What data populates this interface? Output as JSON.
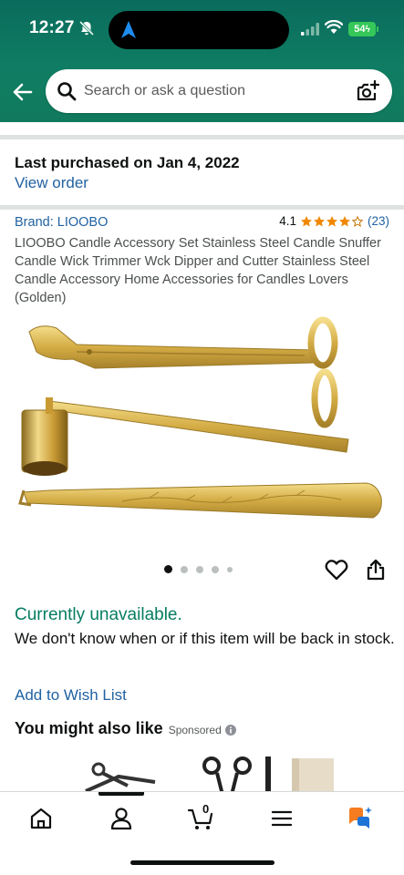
{
  "status_bar": {
    "time": "12:27",
    "battery": "54"
  },
  "search": {
    "placeholder": "Search or ask a question"
  },
  "purchase": {
    "last_purchased": "Last purchased on Jan 4, 2022",
    "view_order": "View order"
  },
  "product": {
    "brand": "Brand: LIOOBO",
    "rating": "4.1",
    "rating_count": "(23)",
    "stars": 4.1,
    "title": "LIOOBO Candle Accessory Set Stainless Steel Candle Snuffer Candle Wick Trimmer Wck Dipper and Cutter Stainless Steel Candle Accessory Home Accessories for Candles Lovers (Golden)",
    "image_count": 5,
    "active_image": 0
  },
  "availability": {
    "status": "Currently unavailable.",
    "note": "We don't know when or if this item will be back in stock.",
    "wishlist": "Add to Wish List"
  },
  "recommendations": {
    "title": "You might also like",
    "sponsored": "Sponsored"
  },
  "bottom_nav": {
    "items": [
      "home-icon",
      "account-icon",
      "cart-icon",
      "menu-icon",
      "rufus-icon"
    ],
    "cart_count": "0"
  },
  "colors": {
    "header": "#0f7d63",
    "link": "#2162a1",
    "available": "#067d62",
    "star": "#f08804",
    "gold": "#d9b648"
  }
}
